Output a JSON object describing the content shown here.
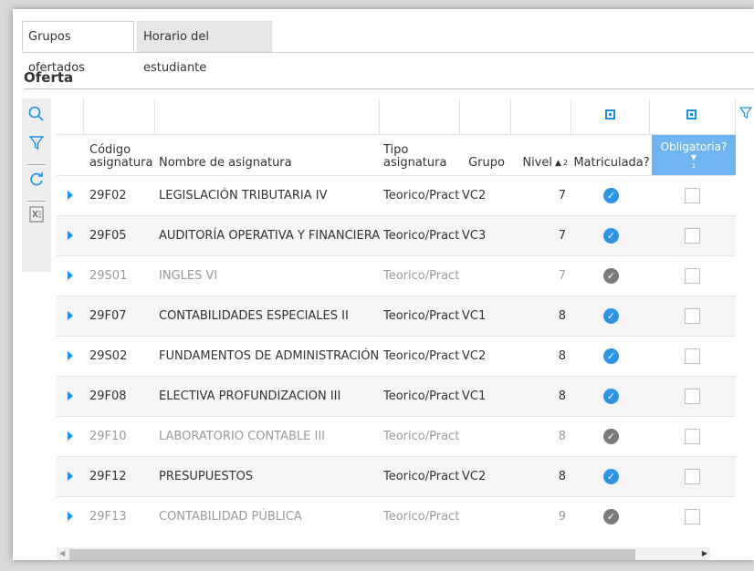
{
  "tabs": [
    {
      "label": "Grupos ofertados",
      "active": true
    },
    {
      "label": "Horario del estudiante",
      "active": false
    }
  ],
  "section_title": "Oferta",
  "toolbar_icons": [
    "search-icon",
    "filter-icon",
    "refresh-icon",
    "export-excel-icon"
  ],
  "columns": {
    "codigo": "Código asignatura",
    "nombre": "Nombre de asignatura",
    "tipo": "Tipo asignatura",
    "grupo": "Grupo",
    "nivel": "Nivel",
    "nivel_sort_index": "2",
    "matriculada": "Matriculada?",
    "obligatoria": "Obligatoria?",
    "obligatoria_sort_index": "1"
  },
  "rows": [
    {
      "codigo": "29F02",
      "nombre": "LEGISLACIÓN TRIBUTARIA IV",
      "tipo": "Teorico/Practi",
      "grupo": "VC2",
      "nivel": "7",
      "matriculada": true,
      "obligatoria": false,
      "enabled": true
    },
    {
      "codigo": "29F05",
      "nombre": "AUDITORÍA OPERATIVA Y FINANCIERA",
      "tipo": "Teorico/Practi",
      "grupo": "VC3",
      "nivel": "7",
      "matriculada": true,
      "obligatoria": false,
      "enabled": true
    },
    {
      "codigo": "29S01",
      "nombre": "INGLES VI",
      "tipo": "Teorico/Practi",
      "grupo": "",
      "nivel": "7",
      "matriculada": true,
      "obligatoria": false,
      "enabled": false
    },
    {
      "codigo": "29F07",
      "nombre": "CONTABILIDADES ESPECIALES II",
      "tipo": "Teorico/Practi",
      "grupo": "VC1",
      "nivel": "8",
      "matriculada": true,
      "obligatoria": false,
      "enabled": true
    },
    {
      "codigo": "29S02",
      "nombre": "FUNDAMENTOS DE ADMINISTRACIÓN PÚ",
      "tipo": "Teorico/Practi",
      "grupo": "VC2",
      "nivel": "8",
      "matriculada": true,
      "obligatoria": false,
      "enabled": true
    },
    {
      "codigo": "29F08",
      "nombre": "ELECTIVA PROFUNDIZACION III",
      "tipo": "Teorico/Practi",
      "grupo": "VC1",
      "nivel": "8",
      "matriculada": true,
      "obligatoria": false,
      "enabled": true
    },
    {
      "codigo": "29F10",
      "nombre": "LABORATORIO CONTABLE III",
      "tipo": "Teorico/Practi",
      "grupo": "",
      "nivel": "8",
      "matriculada": true,
      "obligatoria": false,
      "enabled": false
    },
    {
      "codigo": "29F12",
      "nombre": "PRESUPUESTOS",
      "tipo": "Teorico/Practi",
      "grupo": "VC2",
      "nivel": "8",
      "matriculada": true,
      "obligatoria": false,
      "enabled": true
    },
    {
      "codigo": "29F13",
      "nombre": "CONTABILIDAD PÚBLICA",
      "tipo": "Teorico/Practi",
      "grupo": "",
      "nivel": "9",
      "matriculada": true,
      "obligatoria": false,
      "enabled": false
    }
  ],
  "colors": {
    "accent": "#1a8fe0",
    "check": "#2b95e6",
    "check_disabled": "#7a7a7a",
    "header_highlight": "#6fb5f0"
  }
}
